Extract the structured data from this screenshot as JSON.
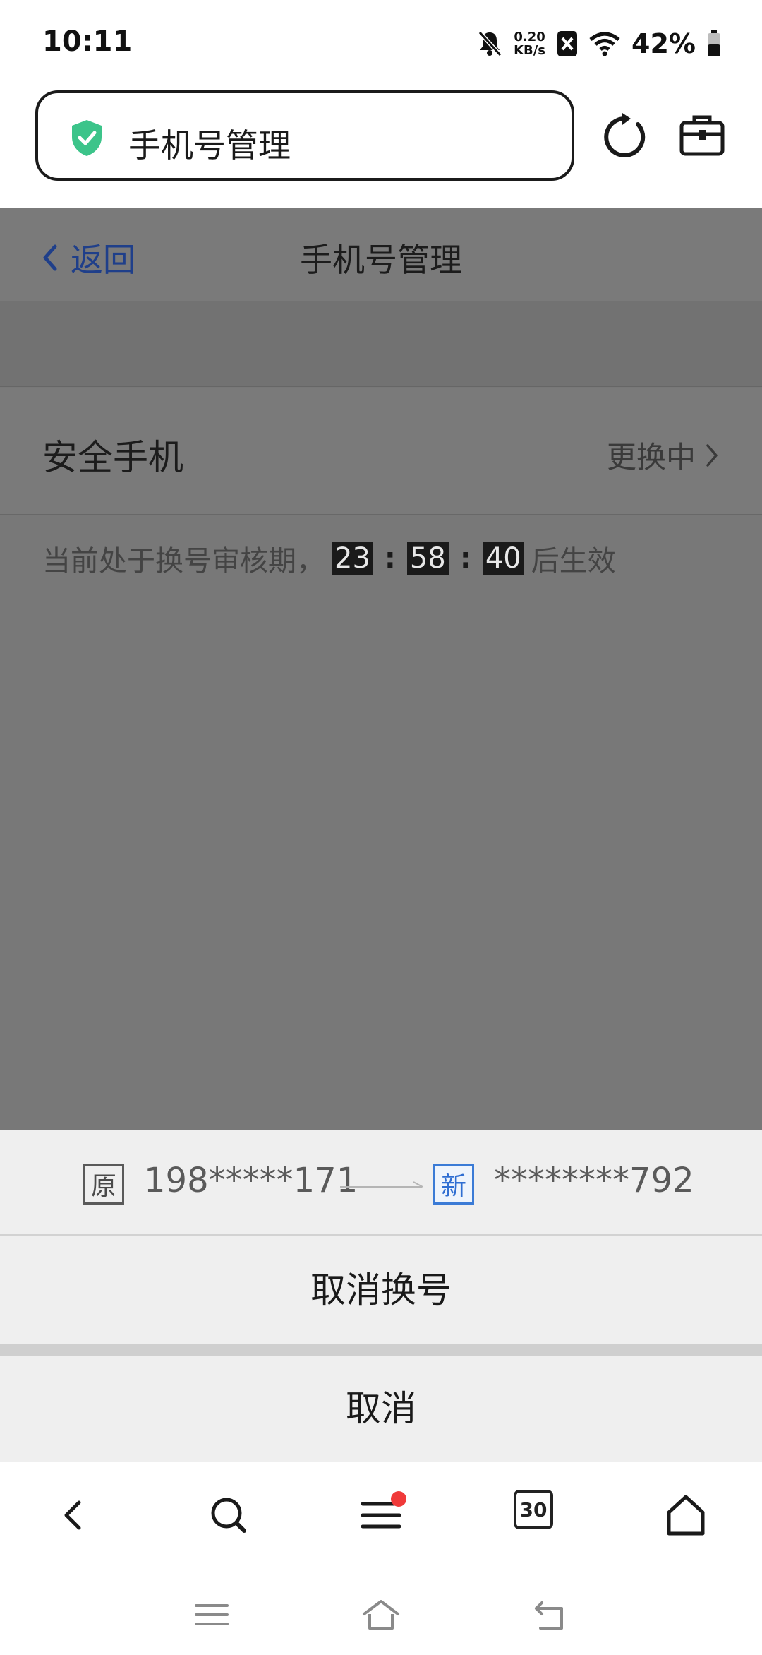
{
  "status_bar": {
    "time": "10:11",
    "net_speed_value": "0.20",
    "net_speed_unit": "KB/s",
    "battery": "42%"
  },
  "browser": {
    "url_title": "手机号管理"
  },
  "page": {
    "back_label": "返回",
    "title": "手机号管理",
    "row_label": "安全手机",
    "row_status": "更换中",
    "notice_prefix": "当前处于换号审核期，",
    "countdown": {
      "hours": "23",
      "minutes": "58",
      "seconds": "40",
      "separator": ":"
    },
    "notice_suffix": "后生效"
  },
  "sheet": {
    "old_tag": "原",
    "old_number": "198*****171",
    "new_tag": "新",
    "new_number": "********792",
    "confirm_label": "取消换号",
    "cancel_label": "取消"
  },
  "bottom_nav": {
    "tab_count": "30"
  },
  "colors": {
    "shield": "#3cc48a",
    "link": "#1f3f8a",
    "new_tag": "#2f6ed2",
    "badge": "#f03a3a"
  }
}
